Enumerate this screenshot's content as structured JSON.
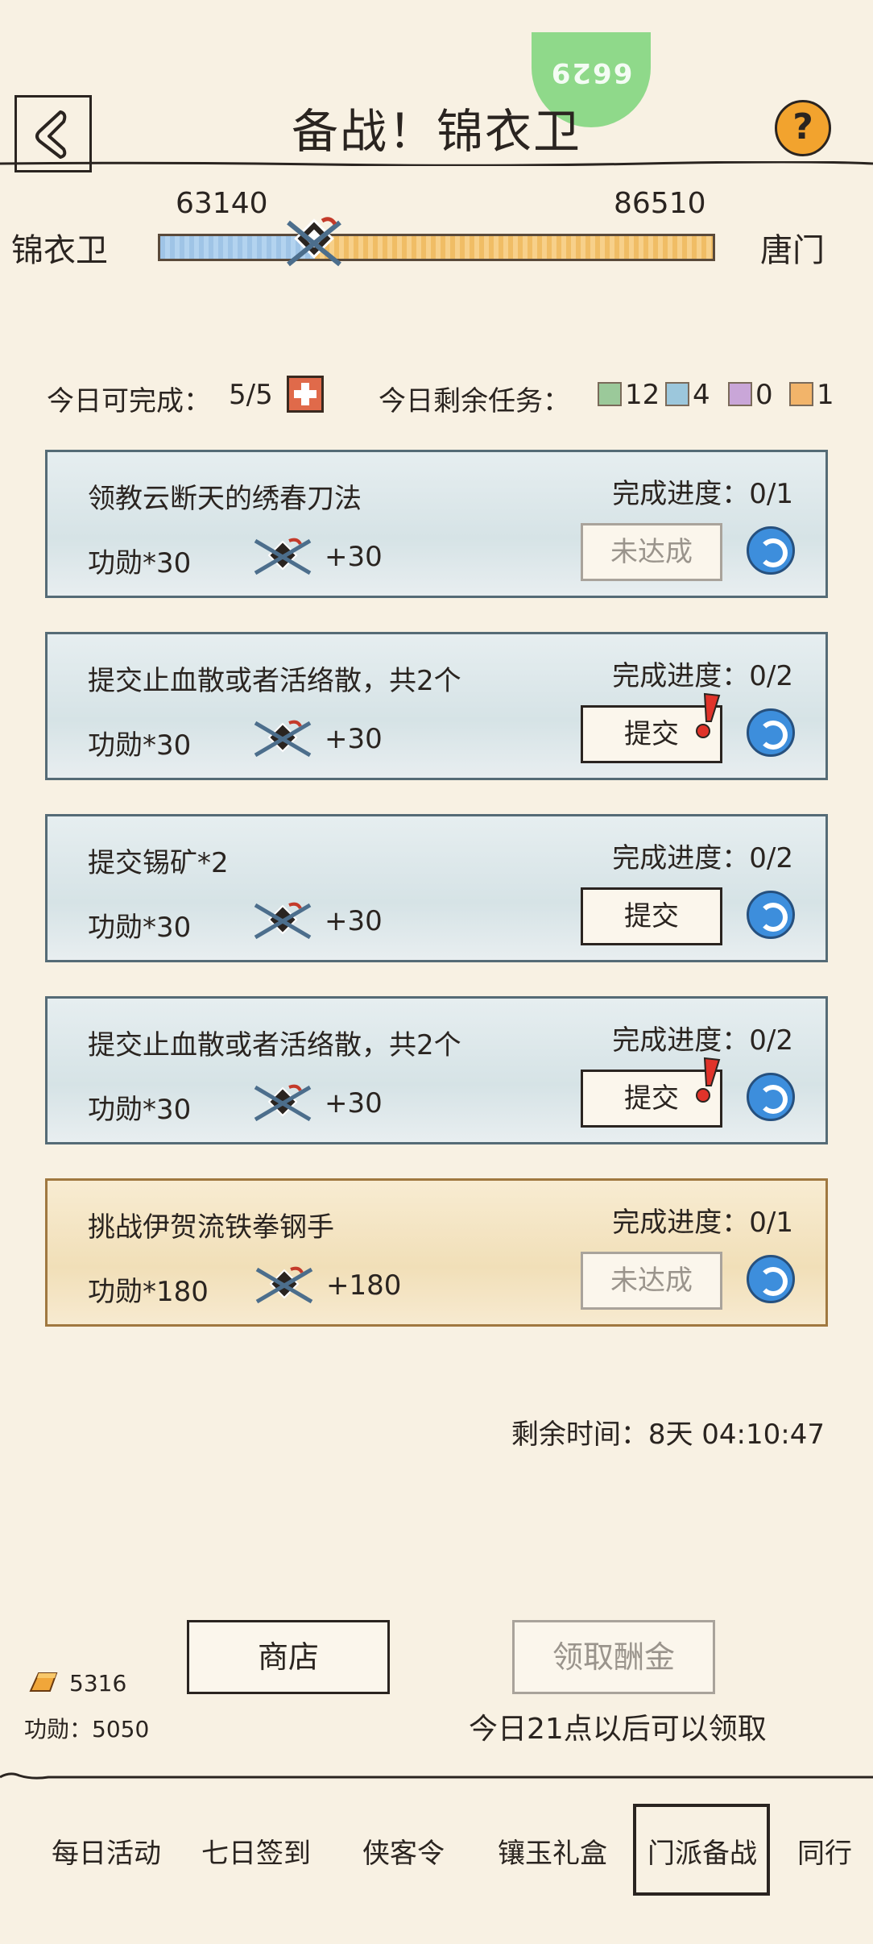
{
  "header": {
    "title": "备战！锦衣卫",
    "badge_number": "6629",
    "help_label": "?"
  },
  "versus": {
    "left_faction": "锦衣卫",
    "right_faction": "唐门",
    "left_score": "63140",
    "right_score": "86510",
    "marker_progress": 0.28,
    "left_color": "#9fc4e6",
    "right_color": "#f5c875"
  },
  "daily": {
    "complete_label": "今日可完成：",
    "complete_value": "5/5",
    "remaining_label": "今日剩余任务：",
    "counts": [
      {
        "color": "#9bc99a",
        "count": "12"
      },
      {
        "color": "#9cc7dc",
        "count": "4"
      },
      {
        "color": "#c9a6d8",
        "count": "0"
      },
      {
        "color": "#f2b46a",
        "count": "1"
      }
    ]
  },
  "tasks": [
    {
      "desc": "领教云断天的绣春刀法",
      "progress": "完成进度：0/1",
      "reward": "功勋*30",
      "plus": "+30",
      "button": "未达成"
    },
    {
      "desc": "提交止血散或者活络散，共2个",
      "progress": "完成进度：0/2",
      "reward": "功勋*30",
      "plus": "+30",
      "button": "提交"
    },
    {
      "desc": "提交锡矿*2",
      "progress": "完成进度：0/2",
      "reward": "功勋*30",
      "plus": "+30",
      "button": "提交"
    },
    {
      "desc": "提交止血散或者活络散，共2个",
      "progress": "完成进度：0/2",
      "reward": "功勋*30",
      "plus": "+30",
      "button": "提交"
    },
    {
      "desc": "挑战伊贺流铁拳钢手",
      "progress": "完成进度：0/1",
      "reward": "功勋*180",
      "plus": "+180",
      "button": "未达成"
    }
  ],
  "timer": "剩余时间：8天 04:10:47",
  "bottom": {
    "shop_label": "商店",
    "claim_label": "领取酬金",
    "claim_hint": "今日21点以后可以领取",
    "gold": "5316",
    "merit": "功勋：5050"
  },
  "tabs": [
    "每日活动",
    "七日签到",
    "侠客令",
    "镶玉礼盒",
    "门派备战",
    "同行"
  ]
}
